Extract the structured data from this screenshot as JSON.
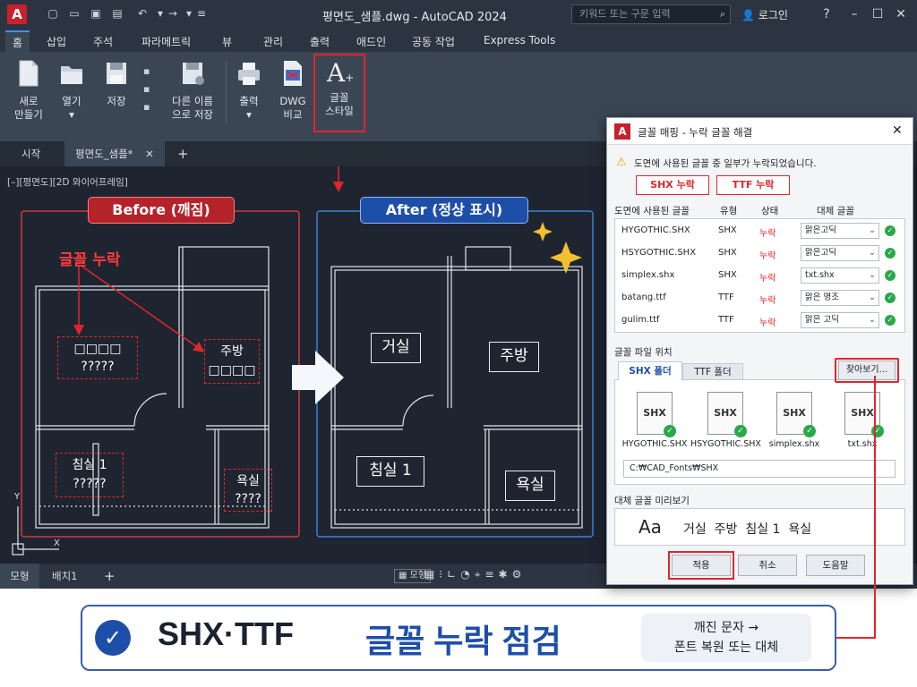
{
  "app": {
    "logo": "A",
    "title": "평면도_샘플.dwg - AutoCAD 2024",
    "search_placeholder": "키워드 또는 구문 입력",
    "login": "로그인",
    "help": "?"
  },
  "menu": {
    "tabs": [
      "홈",
      "삽입",
      "주석",
      "파라메트릭",
      "뷰",
      "관리",
      "출력",
      "애드인",
      "공동 작업",
      "Express Tools"
    ],
    "active_index": 0
  },
  "ribbon": {
    "new_label": "새로\n만들기",
    "open_label": "열기",
    "save_label": "저장",
    "saveas_label": "다른 이름\n으로 저장",
    "plot_label": "출력",
    "dwgcompare_label": "DWG\n비교",
    "fontstyle_label": "글꼴\n스타일"
  },
  "doc_tabs": {
    "start": "시작",
    "active": "평면도_샘플*",
    "close": "✕",
    "add": "+"
  },
  "viewport_label": "[–][평면도][2D 와이어프레임]",
  "before_panel": {
    "title": "Before (깨짐)",
    "missing_label": "글꼴 누락",
    "room1": "□□□□\n?????",
    "room2": "주방\n□□□□",
    "room3": "침실 1\n?????",
    "room4": "욕실\n????"
  },
  "after_panel": {
    "title": "After (정상 표시)",
    "rooms": [
      "거실",
      "주방",
      "침실 1",
      "욕실"
    ]
  },
  "statusbar": {
    "model_tab": "모형",
    "layout_tab": "배치1",
    "add": "+",
    "model_btn": "모형"
  },
  "dialog": {
    "title": "글꼴 매핑 - 누락 글꼴 해결",
    "warning": "도면에 사용된 글꼴 중 일부가 누락되었습니다.",
    "badge_shx": "SHX 누락",
    "badge_ttf": "TTF 누락",
    "table_group": "도면에 사용된 글꼴",
    "col_type": "유형",
    "col_status": "상태",
    "col_sub": "대체 글꼴",
    "rows": [
      {
        "font": "HYGOTHIC.SHX",
        "type": "SHX",
        "status": "누락",
        "sub": "맑은고딕"
      },
      {
        "font": "HSYGOTHIC.SHX",
        "type": "SHX",
        "status": "누락",
        "sub": "맑은고딕"
      },
      {
        "font": "simplex.shx",
        "type": "SHX",
        "status": "누락",
        "sub": "txt.shx"
      },
      {
        "font": "batang.ttf",
        "type": "TTF",
        "status": "누락",
        "sub": "맑은 명조"
      },
      {
        "font": "gulim.ttf",
        "type": "TTF",
        "status": "누락",
        "sub": "맑은 고딕"
      }
    ],
    "location_group": "글꼴 파일 위치",
    "tab_shx": "SHX 폴더",
    "tab_ttf": "TTF 폴더",
    "browse": "찾아보기...",
    "files": [
      {
        "icon": "SHX",
        "name": "HYGOTHIC.SHX"
      },
      {
        "icon": "SHX",
        "name": "HSYGOTHIC.SHX"
      },
      {
        "icon": "SHX",
        "name": "simplex.shx"
      },
      {
        "icon": "SHX",
        "name": "txt.shx"
      }
    ],
    "path": "C:₩CAD_Fonts₩SHX",
    "preview_group": "대체 글꼴 미리보기",
    "preview_aa": "Aa",
    "preview_text": "거실  주방  침실 1  욕실",
    "apply": "적용",
    "cancel": "취소",
    "help": "도움말"
  },
  "banner": {
    "title_black": "SHX·TTF",
    "title_blue": "글꼴 누락 점검",
    "note_line1": "깨진 문자 →",
    "note_line2": "폰트 복원 또는 대체"
  },
  "colors": {
    "accent_red": "#e0262d",
    "accent_blue": "#1e4fa8",
    "titlebar": "#2b3440",
    "ribbon": "#3b4654",
    "canvas": "#1e2530",
    "ok_green": "#2aa84a"
  }
}
